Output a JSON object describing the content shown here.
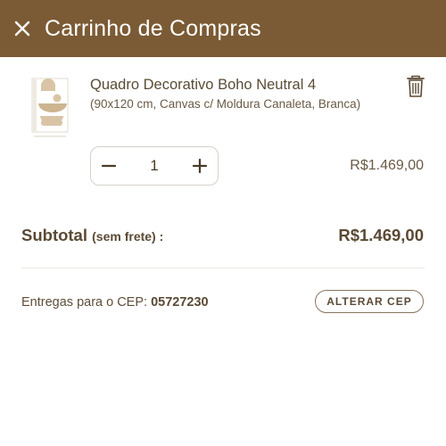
{
  "header": {
    "title": "Carrinho de Compras",
    "close_icon": "close-icon"
  },
  "cart": {
    "items": [
      {
        "title": "Quadro Decorativo Boho Neutral 4",
        "details": "(90x120 cm, Canvas c/ Moldura Canaleta, Branca)",
        "quantity": "1",
        "price": "R$1.469,00",
        "remove_icon": "trash-icon"
      }
    ]
  },
  "summary": {
    "subtotal_label": "Subtotal",
    "subtotal_note": "(sem frete) :",
    "subtotal_value": "R$1.469,00"
  },
  "delivery": {
    "label": "Entregas para o CEP:",
    "cep": "05727230",
    "change_button": "ALTERAR CEP"
  },
  "colors": {
    "header_bg": "#7b5b35",
    "text": "#5a4a34",
    "artwork_accent": "#d9c5a6"
  }
}
